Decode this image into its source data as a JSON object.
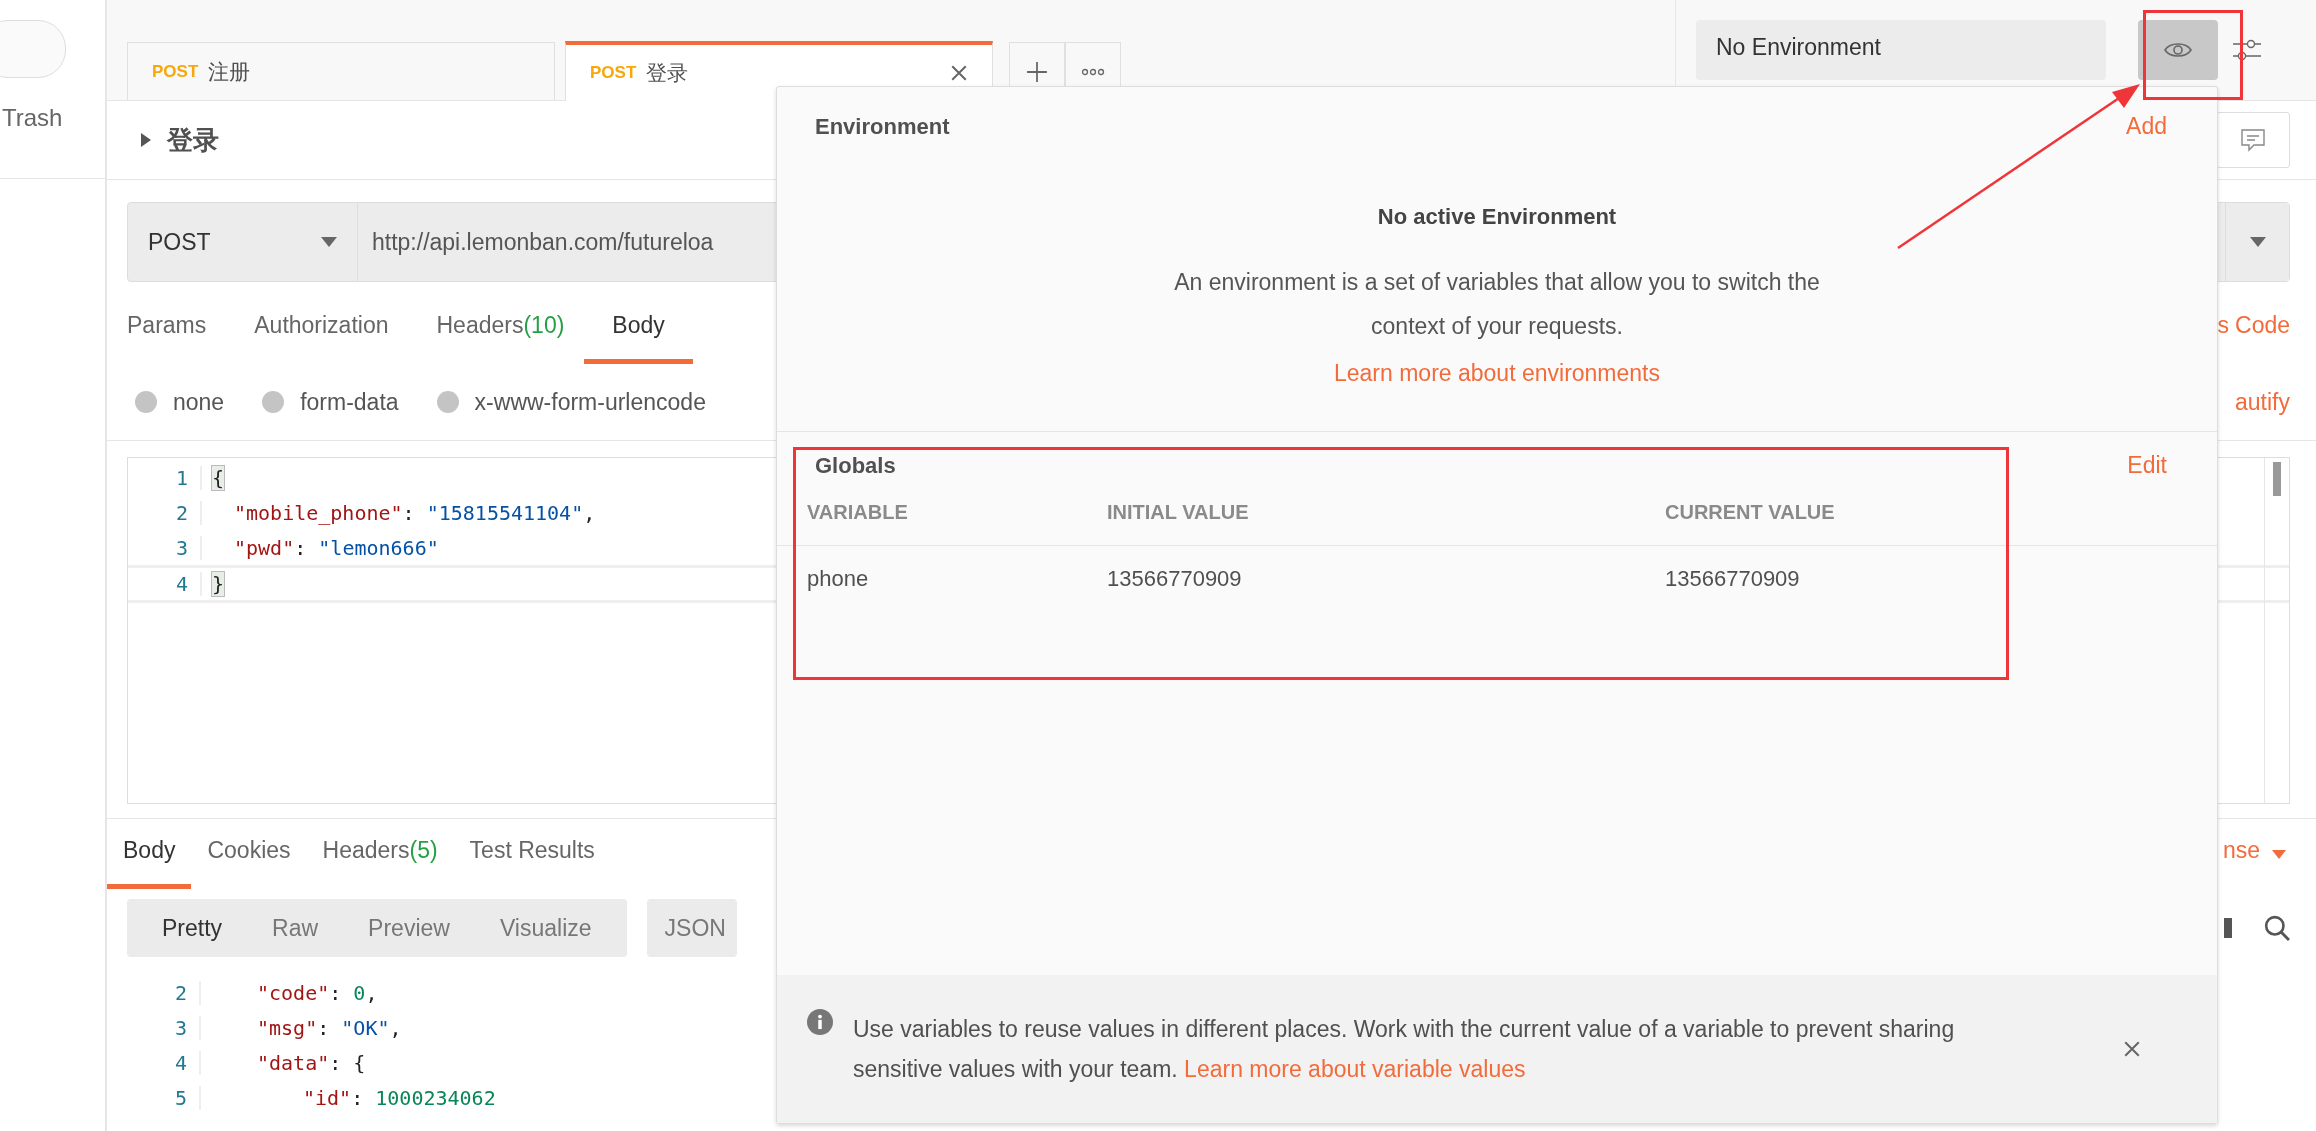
{
  "sidebar": {
    "items": [
      {
        "label": "Trash"
      }
    ]
  },
  "tabs": [
    {
      "method": "POST",
      "label": "注册",
      "selected": false
    },
    {
      "method": "POST",
      "label": "登录",
      "selected": true
    }
  ],
  "environment": {
    "selected": "No Environment"
  },
  "request": {
    "title": "登录",
    "method": "POST",
    "url": "http://api.lemonban.com/futureloa",
    "tabs": [
      {
        "label": "Params",
        "selected": false
      },
      {
        "label": "Authorization",
        "selected": false
      },
      {
        "label": "Headers",
        "count": "(10)",
        "selected": false
      },
      {
        "label": "Body",
        "selected": true
      }
    ],
    "side_links": [
      "s",
      "Code"
    ],
    "body_modes": [
      {
        "label": "none",
        "selected": false
      },
      {
        "label": "form-data",
        "selected": false
      },
      {
        "label": "x-www-form-urlencode",
        "selected": false
      }
    ],
    "beautify": "autify",
    "lines": [
      {
        "number": "1",
        "kind": "root",
        "active": false,
        "tokens": [
          {
            "kind": "match",
            "text": "{"
          }
        ]
      },
      {
        "number": "2",
        "kind": "depth1",
        "active": false,
        "tokens": [
          {
            "kind": "key",
            "text": "\"mobile_phone\""
          },
          {
            "kind": "plain",
            "text": ": "
          },
          {
            "kind": "string",
            "text": "\"15815541104\""
          },
          {
            "kind": "plain",
            "text": ","
          }
        ]
      },
      {
        "number": "3",
        "kind": "depth1",
        "active": false,
        "tokens": [
          {
            "kind": "key",
            "text": "\"pwd\""
          },
          {
            "kind": "plain",
            "text": ": "
          },
          {
            "kind": "string",
            "text": "\"lemon666\""
          }
        ]
      },
      {
        "number": "4",
        "kind": "root",
        "active": true,
        "tokens": [
          {
            "kind": "match",
            "text": "}"
          }
        ]
      }
    ]
  },
  "response": {
    "tabs": [
      {
        "label": "Body",
        "selected": true
      },
      {
        "label": "Cookies",
        "selected": false
      },
      {
        "label": "Headers",
        "count": "(5)",
        "selected": false
      },
      {
        "label": "Test Results",
        "selected": false
      }
    ],
    "save": "nse",
    "formats": [
      {
        "label": "Pretty",
        "selected": true
      },
      {
        "label": "Raw",
        "selected": false
      },
      {
        "label": "Preview",
        "selected": false
      },
      {
        "label": "Visualize",
        "selected": false
      }
    ],
    "language": "JSON",
    "lines": [
      {
        "number": "2",
        "kind": "depth1",
        "tokens": [
          {
            "kind": "key",
            "text": "\"code\""
          },
          {
            "kind": "plain",
            "text": ": "
          },
          {
            "kind": "number",
            "text": "0"
          },
          {
            "kind": "plain",
            "text": ","
          }
        ]
      },
      {
        "number": "3",
        "kind": "depth1",
        "tokens": [
          {
            "kind": "key",
            "text": "\"msg\""
          },
          {
            "kind": "plain",
            "text": ": "
          },
          {
            "kind": "string",
            "text": "\"OK\""
          },
          {
            "kind": "plain",
            "text": ","
          }
        ]
      },
      {
        "number": "4",
        "kind": "depth1",
        "tokens": [
          {
            "kind": "key",
            "text": "\"data\""
          },
          {
            "kind": "plain",
            "text": ": {"
          }
        ]
      },
      {
        "number": "5",
        "kind": "depth2",
        "tokens": [
          {
            "kind": "key",
            "text": "\"id\""
          },
          {
            "kind": "plain",
            "text": ": "
          },
          {
            "kind": "number",
            "text": "1000234062"
          }
        ]
      }
    ]
  },
  "popover": {
    "title": "Environment",
    "add": "Add",
    "empty_title": "No active Environment",
    "empty_text": "An environment is a set of variables that allow you to switch the context of your requests.",
    "learn_link": "Learn more about environments",
    "globals": {
      "title": "Globals",
      "edit": "Edit",
      "columns": [
        "VARIABLE",
        "INITIAL VALUE",
        "CURRENT VALUE"
      ],
      "rows": [
        [
          "phone",
          "13566770909",
          "13566770909"
        ]
      ]
    },
    "tip": {
      "text": "Use variables to reuse values in different places. Work with the current value of a variable to prevent sharing sensitive values with your team.",
      "link": "Learn more about variable values"
    }
  }
}
